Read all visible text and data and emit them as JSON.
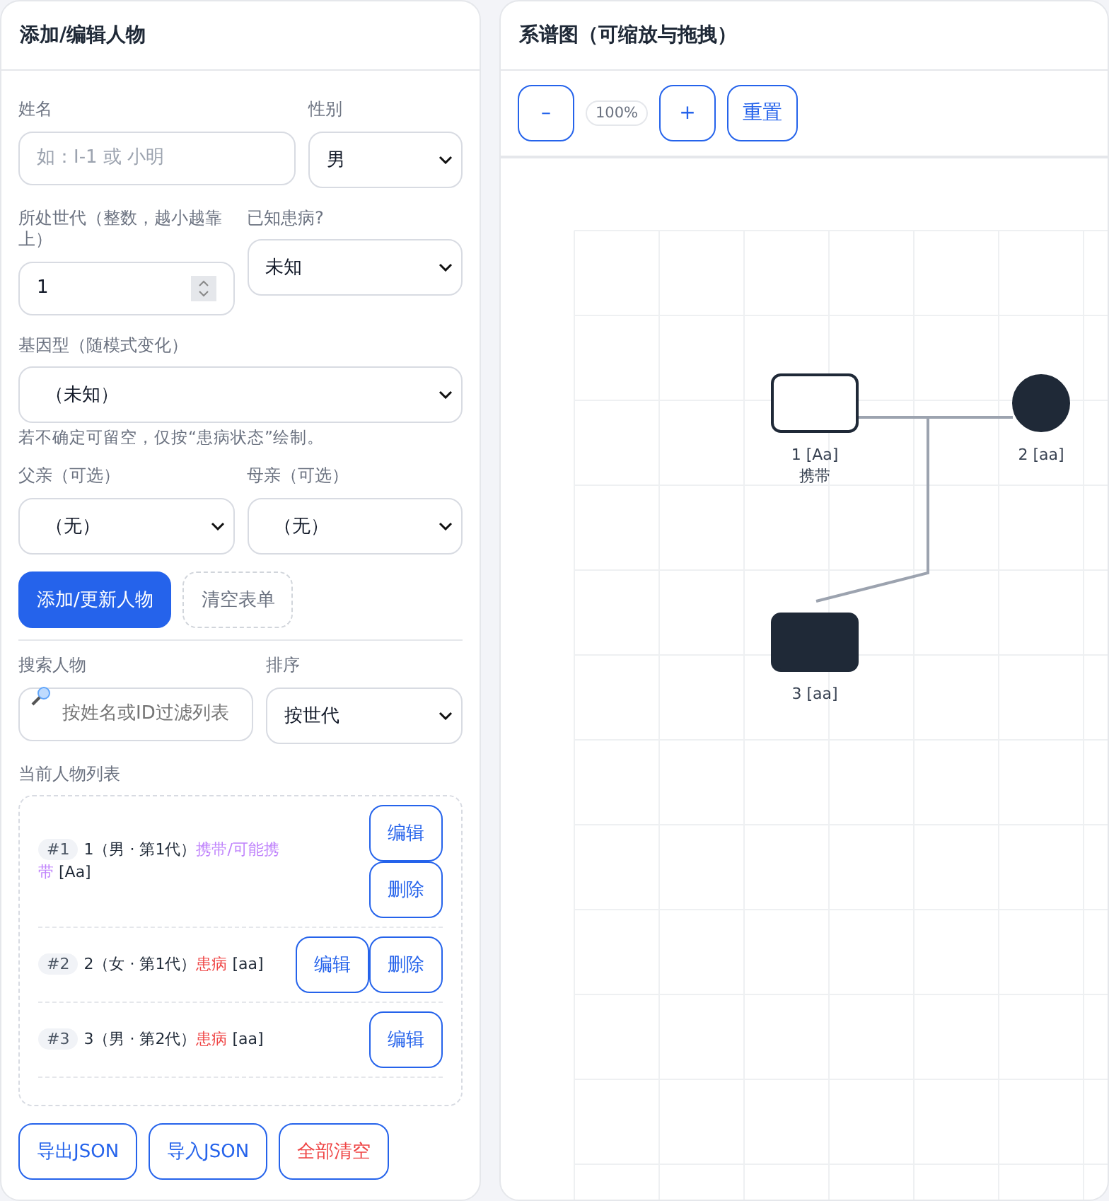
{
  "form_panel": {
    "title": "添加/编辑人物",
    "name_field": {
      "label": "姓名",
      "placeholder": "如：I-1 或 小明"
    },
    "sex_field": {
      "label": "性别",
      "value": "男"
    },
    "generation_field": {
      "label": "所处世代（整数，越小越靠上）",
      "value": "1"
    },
    "affected_field": {
      "label": "已知患病?",
      "value": "未知"
    },
    "genotype_field": {
      "label": "基因型（随模式变化）",
      "value": "（未知）",
      "hint": "若不确定可留空，仅按“患病状态”绘制。"
    },
    "father_field": {
      "label": "父亲（可选）",
      "value": "（无）"
    },
    "mother_field": {
      "label": "母亲（可选）",
      "value": "（无）"
    },
    "buttons": [
      {
        "label": "添加/更新人物",
        "kind": "primary"
      },
      {
        "label": "清空表单",
        "kind": "ghost"
      }
    ],
    "search_field": {
      "label": "搜索人物",
      "placeholder": "按姓名或ID过滤列表"
    },
    "sort_field": {
      "label": "排序",
      "value": "按世代"
    },
    "list_label": "当前人物列表",
    "people": [
      {
        "tag": "#1",
        "text": "1（男 · 第1代）",
        "status": "携带/可能携带",
        "color": "#c084fc",
        "genotype": "[Aa]",
        "edit": "编辑",
        "delete": "删除"
      },
      {
        "tag": "#2",
        "text": "2（女 · 第1代）",
        "status": "患病",
        "color": "#ef4444",
        "genotype": "[aa]",
        "edit": "编辑",
        "delete": "删除"
      },
      {
        "tag": "#3",
        "text": "3（男 · 第2代）",
        "status": "患病",
        "color": "#ef4444",
        "genotype": "[aa]",
        "edit": "编辑"
      }
    ],
    "footer_buttons": [
      {
        "label": "导出JSON",
        "kind": "normal"
      },
      {
        "label": "导入JSON",
        "kind": "normal"
      },
      {
        "label": "全部清空",
        "kind": "danger"
      }
    ]
  },
  "chart_panel": {
    "title": "系谱图（可缩放与拖拽）",
    "toolbar": {
      "zoom_out": "–",
      "zoom": "100%",
      "zoom_in": "+",
      "reset": "重置"
    },
    "nodes": [
      {
        "kind": "male",
        "affected": false,
        "label": "1 [Aa]",
        "note": "携带"
      },
      {
        "kind": "female",
        "affected": true,
        "label": "2 [aa]"
      },
      {
        "kind": "male",
        "affected": true,
        "label": "3 [aa]"
      }
    ]
  }
}
